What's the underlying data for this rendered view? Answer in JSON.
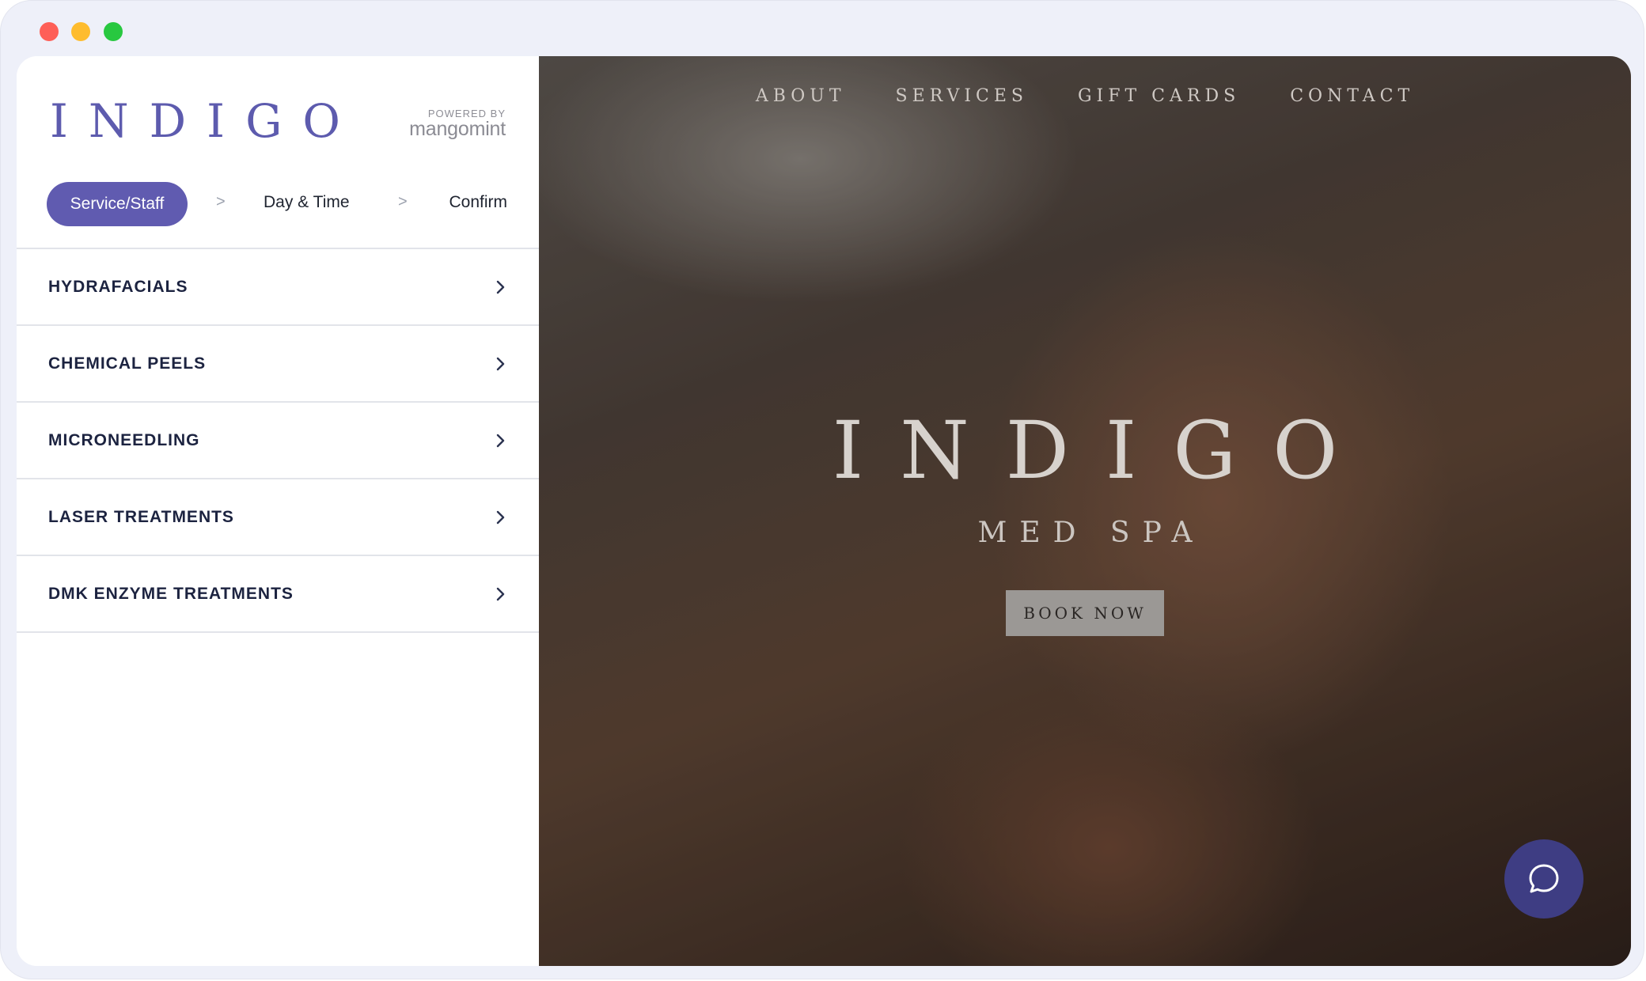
{
  "window": {
    "controls": [
      "close",
      "minimize",
      "maximize"
    ]
  },
  "panel": {
    "logo": "INDIGO",
    "powered_by": {
      "label": "POWERED BY",
      "brand": "mangomint"
    },
    "steps": [
      {
        "label": "Service/Staff",
        "active": true
      },
      {
        "label": "Day & Time",
        "active": false
      },
      {
        "label": "Confirm",
        "active": false
      }
    ],
    "step_separator": ">",
    "categories": [
      {
        "label": "HYDRAFACIALS"
      },
      {
        "label": "CHEMICAL PEELS"
      },
      {
        "label": "MICRONEEDLING"
      },
      {
        "label": "LASER TREATMENTS"
      },
      {
        "label": "DMK ENZYME TREATMENTS"
      }
    ]
  },
  "hero": {
    "nav": [
      "ABOUT",
      "SERVICES",
      "GIFT CARDS",
      "CONTACT"
    ],
    "title": "INDIGO",
    "subtitle": "MED SPA",
    "cta": "BOOK NOW"
  },
  "colors": {
    "accent": "#605bb0",
    "chat_button": "#3e3d83",
    "text_dark": "#1c2340"
  },
  "icons": {
    "chevron": "chevron-right-icon",
    "chat": "chat-bubble-icon"
  }
}
